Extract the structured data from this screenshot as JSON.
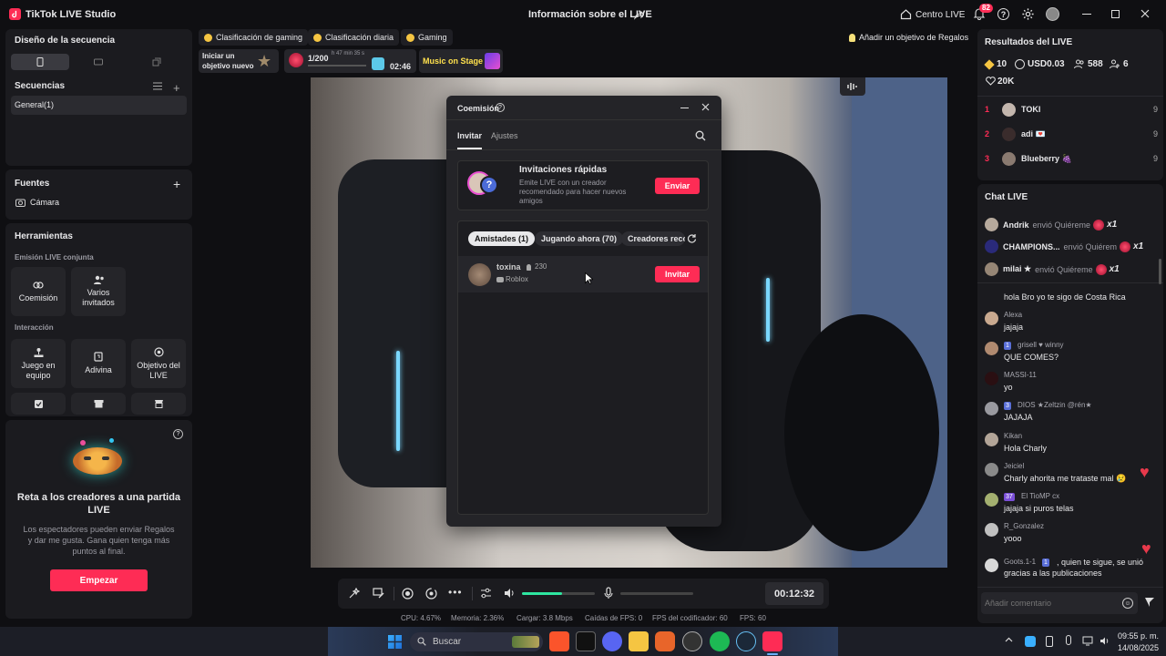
{
  "app": {
    "title": "TikTok LIVE Studio",
    "center_title": "Información sobre el LIVE",
    "centro_label": "Centro LIVE",
    "notif_count": "82"
  },
  "left": {
    "seq_design_title": "Diseño de la secuencia",
    "sequences_title": "Secuencias",
    "sequence_item": "General(1)",
    "sources_title": "Fuentes",
    "source_item": "Cámara",
    "tools_title": "Herramientas",
    "coop_title": "Emisión LIVE conjunta",
    "tools_coop": [
      "Coemisión",
      "Varios invitados"
    ],
    "interaction_title": "Interacción",
    "tools_interaction": [
      "Juego en equipo",
      "Adivina",
      "Objetivo del LIVE"
    ],
    "promo_title": "Reta a los creadores a una partida LIVE",
    "promo_text": "Los espectadores pueden enviar Regalos y dar me gusta. Gana quien tenga más puntos al final.",
    "promo_button": "Empezar"
  },
  "tags": {
    "items": [
      "Clasificación de gaming",
      "Clasificación diaria",
      "Gaming"
    ],
    "add_goal": "Añadir un objetivo de Regalos"
  },
  "widgets": {
    "goal_line1": "Iniciar un",
    "goal_line2": "objetivo nuevo",
    "rose_count": "1/200",
    "rose_time": "h 47 min 35 s",
    "timer": "02:46",
    "music": "Music on Stage"
  },
  "modal": {
    "title": "Coemisión",
    "tab_invite": "Invitar",
    "tab_settings": "Ajustes",
    "quick_title": "Invitaciones rápidas",
    "quick_text": "Emite LIVE con un creador recomendado para hacer nuevos amigos",
    "quick_button": "Enviar",
    "chips": [
      "Amistades (1)",
      "Jugando ahora (70)",
      "Creadores reco"
    ],
    "friend_name": "toxina",
    "friend_count": "230",
    "friend_game": "Roblox",
    "invite_button": "Invitar"
  },
  "controls": {
    "time": "00:12:32",
    "volume_level": 0.55
  },
  "stats": {
    "cpu": "CPU:  4.67%",
    "memory": "Memoria:  2.36%",
    "load": "Cargar:  3.8 Mbps",
    "fps_drops": "Caídas de FPS:  0",
    "encoder_fps": "FPS del codificador:  60",
    "fps": "FPS:  60"
  },
  "results": {
    "title": "Resultados del LIVE",
    "diamonds": "10",
    "usd": "USD0.03",
    "viewers": "588",
    "followers": "6",
    "likes": "20K",
    "ranking": [
      {
        "rank": "1",
        "name": "TOKI",
        "score": "9"
      },
      {
        "rank": "2",
        "name": "adi 💌",
        "score": "9"
      },
      {
        "rank": "3",
        "name": "Blueberry 🍇",
        "score": "9"
      }
    ]
  },
  "chat": {
    "title": "Chat LIVE",
    "gifts": [
      {
        "user": "Andrik",
        "action": "envió Quiéreme",
        "count": "x1"
      },
      {
        "user": "CHAMPIONS...",
        "action": "envió Quiérem",
        "count": "x1"
      },
      {
        "user": "milai ★",
        "action": "envió Quiéreme",
        "count": "x1"
      }
    ],
    "first_message": "hola Bro yo te sigo de Costa Rica",
    "messages": [
      {
        "user": "Alexa",
        "badge": "",
        "text": "jajaja"
      },
      {
        "user": "grisell ♥ winny",
        "badge": "1",
        "text": "QUE COMES?"
      },
      {
        "user": "MASSI-11",
        "badge": "",
        "text": "yo"
      },
      {
        "user": "DIOS ★Zeltzin @rén★",
        "badge": "3",
        "text": "JAJAJA"
      },
      {
        "user": "Kikan",
        "badge": "",
        "text": "Hola Charly"
      },
      {
        "user": "Jeiciel",
        "badge": "",
        "text": "Charly ahorita me trataste mal 😢"
      },
      {
        "user": "El TioMP cx",
        "badge": "37",
        "text": "jajaja si puros telas"
      },
      {
        "user": "R_Gonzalez",
        "badge": "",
        "text": "yooo"
      }
    ],
    "system_user": "Goots.1-1",
    "system_badge": "1",
    "system_text": ", quien te sigue, se unió gracias a las publicaciones",
    "input_placeholder": "Añadir comentario"
  },
  "taskbar": {
    "search_placeholder": "Buscar",
    "time": "09:55 p. m.",
    "date": "14/08/2025"
  },
  "colors": {
    "accent": "#fe2c55",
    "volume": "#2ee6a0",
    "panel": "#1b1b1f"
  }
}
